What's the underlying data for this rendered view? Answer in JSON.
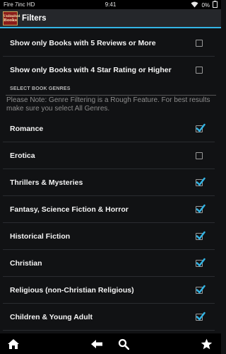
{
  "status_bar": {
    "device": "Fire 7inc HD",
    "time": "9:41",
    "battery": "0%",
    "icons": [
      "wifi-icon",
      "battery-icon"
    ]
  },
  "action_bar": {
    "logo_text": [
      "Unlimited",
      "Books"
    ],
    "title": "Filters"
  },
  "filters": [
    {
      "label": "Show only Books with 5 Reviews or More",
      "checked": false
    },
    {
      "label": "Show only Books with 4 Star Rating or Higher",
      "checked": false
    }
  ],
  "genres_section": {
    "header": "SELECT BOOK GENRES",
    "note": "Please Note: Genre Filtering is a Rough Feature. For best results make sure you select All Genres."
  },
  "genres": [
    {
      "label": "Romance",
      "checked": true
    },
    {
      "label": "Erotica",
      "checked": false
    },
    {
      "label": "Thrillers & Mysteries",
      "checked": true
    },
    {
      "label": "Fantasy, Science Fiction & Horror",
      "checked": true
    },
    {
      "label": "Historical Fiction",
      "checked": true
    },
    {
      "label": "Christian",
      "checked": true
    },
    {
      "label": "Religious (non-Christian Religious)",
      "checked": true
    },
    {
      "label": "Children & Young Adult",
      "checked": true
    }
  ],
  "nav_bar": {
    "icons": [
      "home-icon",
      "back-icon",
      "search-icon",
      "favorites-icon"
    ]
  },
  "colors": {
    "accent": "#33b5e5",
    "background": "#111214",
    "action_bar": "#25272b",
    "check_blue": "#33b5e5"
  }
}
